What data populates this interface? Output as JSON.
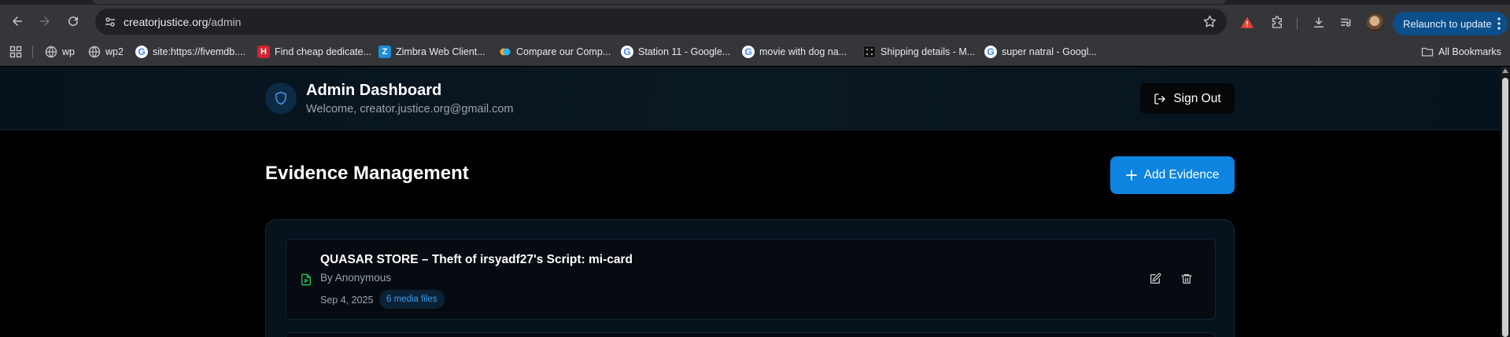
{
  "browser": {
    "url_host": "creatorjustice.org",
    "url_path": "/admin",
    "relaunch_label": "Relaunch to update",
    "icons": [
      "back-icon",
      "forward-icon",
      "reload-icon",
      "site-info-icon",
      "star-icon",
      "warning-icon",
      "extensions-icon",
      "download-icon",
      "media-control-icon",
      "profile-avatar",
      "more-icon"
    ],
    "bookmarks": [
      {
        "label": "wp",
        "icon": "globe-icon"
      },
      {
        "label": "wp2",
        "icon": "globe-icon"
      },
      {
        "label": "site:https://fivemdb....",
        "icon": "google-icon"
      },
      {
        "label": "Find cheap dedicate...",
        "icon": "hotel-icon"
      },
      {
        "label": "Zimbra Web Client...",
        "icon": "zimbra-icon"
      },
      {
        "label": "Compare our Comp...",
        "icon": "circles-icon"
      },
      {
        "label": "Station 11 - Google...",
        "icon": "google-icon"
      },
      {
        "label": "movie with dog na...",
        "icon": "google-icon"
      },
      {
        "label": "Shipping details - M...",
        "icon": "shipping-icon"
      },
      {
        "label": "super natral - Googl...",
        "icon": "google-icon"
      }
    ],
    "all_bookmarks_label": "All Bookmarks"
  },
  "header": {
    "title": "Admin Dashboard",
    "welcome": "Welcome, creator.justice.org@gmail.com",
    "signout_label": "Sign Out"
  },
  "main": {
    "section_title": "Evidence Management",
    "add_label": "Add Evidence",
    "evidence": [
      {
        "title": "QUASAR STORE – Theft of irsyadf27's Script: mi-card",
        "author": "By Anonymous",
        "date": "Sep 4, 2025",
        "media": "6 media files"
      }
    ]
  },
  "colors": {
    "accent": "#0c84e0",
    "badge_text": "#3d9be9",
    "file_icon": "#22c55e",
    "warning": "#ea4335",
    "relaunch_bg": "#0b4f8a"
  }
}
